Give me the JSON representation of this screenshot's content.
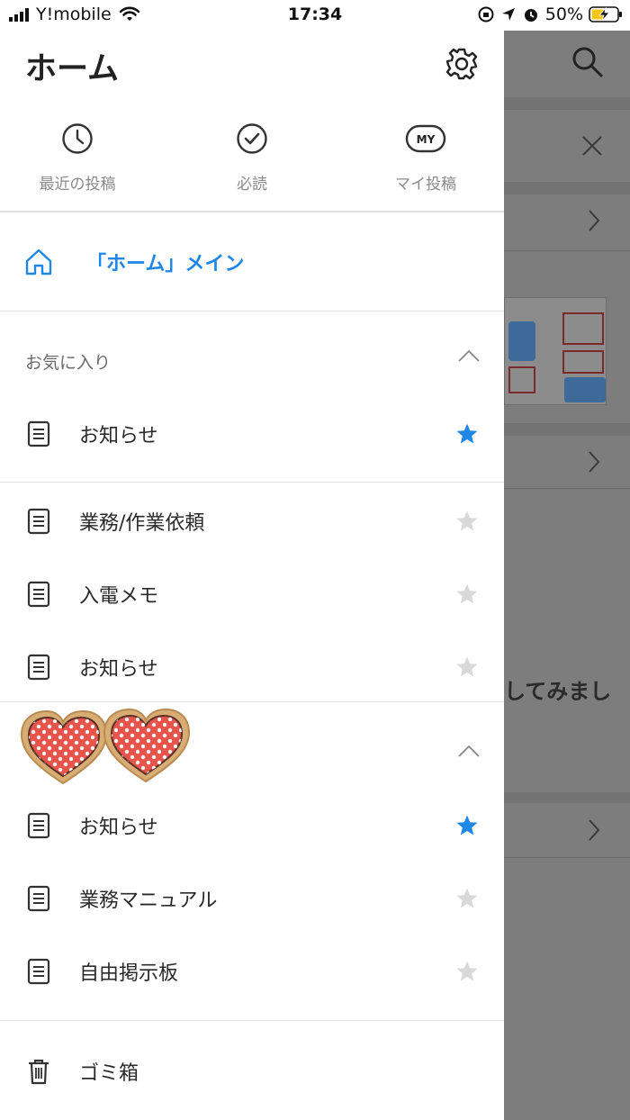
{
  "status_bar": {
    "carrier": "Y!mobile",
    "time": "17:34",
    "battery": "50%"
  },
  "drawer": {
    "title": "ホーム",
    "quick_actions": [
      {
        "label": "最近の投稿",
        "icon": "clock-icon"
      },
      {
        "label": "必読",
        "icon": "check-circle-icon"
      },
      {
        "label": "マイ投稿",
        "icon": "my-badge-icon",
        "badge": "MY"
      }
    ],
    "home_link": "「ホーム」メイン",
    "favorites": {
      "header": "お気に入り",
      "items": [
        {
          "label": "お知らせ",
          "starred": true
        }
      ]
    },
    "groups": [
      {
        "items": [
          {
            "label": "業務/作業依頼",
            "starred": false
          },
          {
            "label": "入電メモ",
            "starred": false
          },
          {
            "label": "お知らせ",
            "starred": false
          }
        ]
      },
      {
        "header_image": "hearts-sticker",
        "items": [
          {
            "label": "お知らせ",
            "starred": true
          },
          {
            "label": "業務マニュアル",
            "starred": false
          },
          {
            "label": "自由掲示板",
            "starred": false
          }
        ]
      }
    ],
    "trash": "ゴミ箱"
  },
  "background": {
    "partial_text": "してみまし"
  },
  "colors": {
    "accent": "#1f87e5",
    "star_active": "#1f87e5",
    "star_inactive": "#d9d9d9",
    "overlay": "#7c7c7c"
  }
}
